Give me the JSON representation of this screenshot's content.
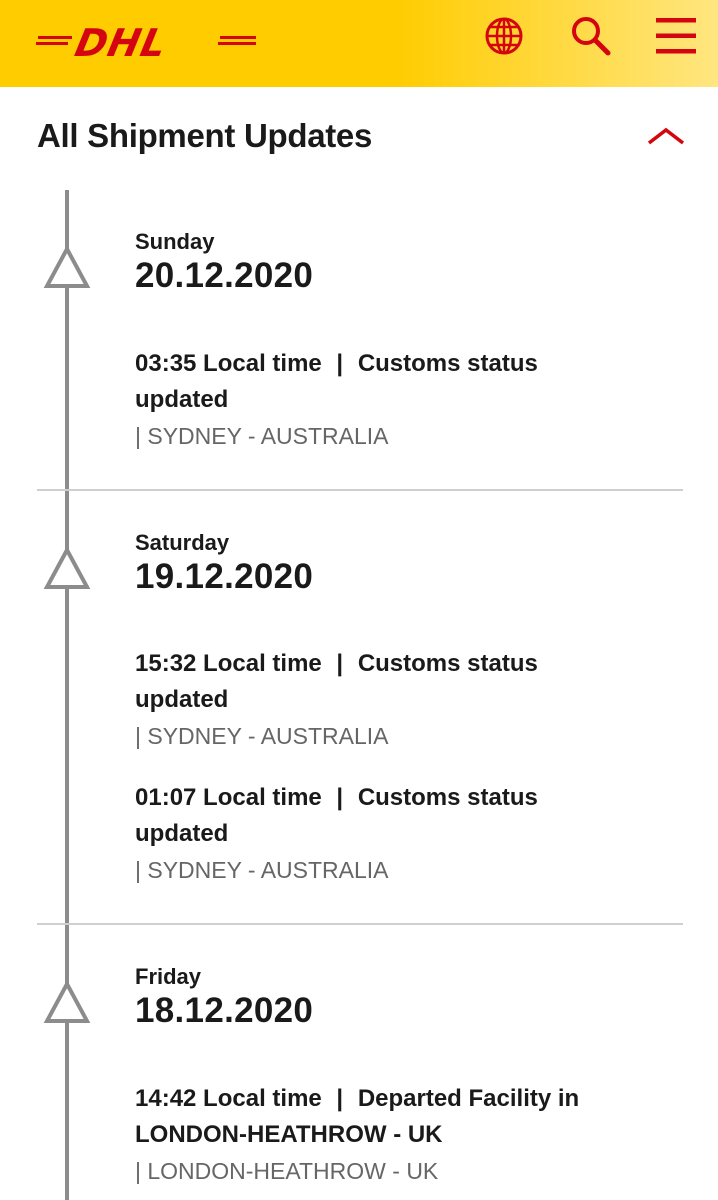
{
  "header": {
    "logo_text": "DHL",
    "brand_yellow": "#ffcc00",
    "brand_red": "#d40511",
    "icons": [
      "globe-icon",
      "search-icon",
      "menu-icon"
    ]
  },
  "section": {
    "title": "All Shipment Updates",
    "toggle_icon": "chevron-up-icon"
  },
  "days": [
    {
      "weekday": "Sunday",
      "date": "20.12.2020",
      "events": [
        {
          "time": "03:35 Local time",
          "sep": "|",
          "status": "Customs status",
          "status_cont": "updated",
          "location": "| SYDNEY - AUSTRALIA"
        }
      ]
    },
    {
      "weekday": "Saturday",
      "date": "19.12.2020",
      "events": [
        {
          "time": "15:32 Local time",
          "sep": "|",
          "status": "Customs status",
          "status_cont": "updated",
          "location": "| SYDNEY - AUSTRALIA"
        },
        {
          "time": "01:07 Local time",
          "sep": "|",
          "status": "Customs status",
          "status_cont": "updated",
          "location": "| SYDNEY - AUSTRALIA"
        }
      ]
    },
    {
      "weekday": "Friday",
      "date": "18.12.2020",
      "events": [
        {
          "time": "14:42 Local time",
          "sep": "|",
          "status": "Departed Facility in",
          "status_cont": "LONDON-HEATHROW - UK",
          "location": "| LONDON-HEATHROW - UK"
        }
      ]
    }
  ]
}
